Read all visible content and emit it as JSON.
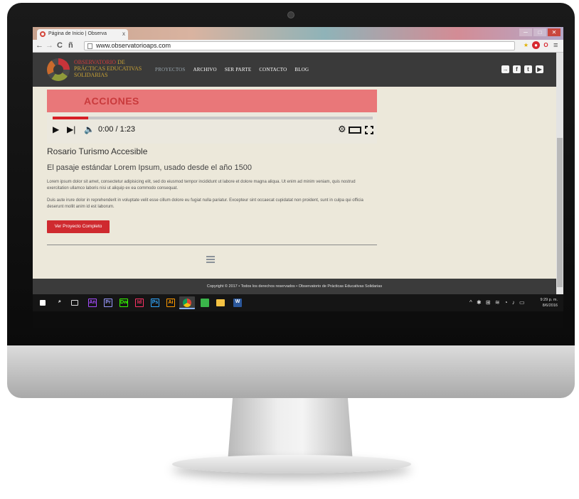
{
  "browser": {
    "tab_title": "Página de Inicio | Observa",
    "tab_close": "x",
    "url": "www.observatorioaps.com",
    "back": "←",
    "forward": "→",
    "reload": "C",
    "home": "ñ",
    "menu": "≡",
    "window_controls": [
      "─",
      "□",
      "✕"
    ]
  },
  "site": {
    "logo": {
      "line1_a": "OBSERVATORIO",
      "line1_b": "DE",
      "line2_a": "PRÁCTICAS",
      "line2_b": "EDUCATIVAS",
      "line3": "SOLIDARIAS"
    },
    "nav": [
      "PROYECTOS",
      "ARCHIVO",
      "SER PARTE",
      "CONTACTO",
      "BLOG"
    ],
    "nav_active": "PROYECTOS",
    "social_icons": [
      "login-icon",
      "facebook-icon",
      "twitter-icon",
      "youtube-icon"
    ]
  },
  "video": {
    "banner_text": "ACCIONES",
    "time": "0:00 / 1:23",
    "progress": 0.11
  },
  "project": {
    "title": "Rosario Turismo Accesible",
    "subtitle": "El pasaje estándar Lorem Ipsum, usado desde el año 1500",
    "paragraph1": "Lorem ipsum dolor sit amet, consectetur adipisicing elit, sed do eiusmod tempor incididunt ut labore et dolore magna aliqua. Ut enim ad minim veniam, quis nostrud exercitation ullamco laboris nisi ut aliquip ex ea commodo consequat.",
    "paragraph2": "Duis aute irure dolor in reprehenderit in voluptate velit esse cillum dolore eu fugiat nulla pariatur. Excepteur sint occaecat cupidatat non proident, sunt in culpa qui officia deserunt mollit anim id est laborum.",
    "button": "Ver Proyecto Completo"
  },
  "footer": {
    "text": "Copyright © 2017 • Todos los derechos reservados • Observatorio de Prácticas Educativas Solidarias"
  },
  "taskbar": {
    "apps": [
      {
        "name": "start-icon",
        "label": "",
        "color": "#ffffff"
      },
      {
        "name": "search-icon",
        "label": "",
        "color": "#ffffff"
      },
      {
        "name": "task-view-icon",
        "label": "",
        "color": "#ffffff"
      },
      {
        "name": "animate-icon",
        "label": "An",
        "color": "#a64dff"
      },
      {
        "name": "premiere-icon",
        "label": "Pr",
        "color": "#9999ff"
      },
      {
        "name": "dreamweaver-icon",
        "label": "Dw",
        "color": "#35fa00"
      },
      {
        "name": "indesign-icon",
        "label": "Id",
        "color": "#ff3366"
      },
      {
        "name": "photoshop-icon",
        "label": "Ps",
        "color": "#31a8ff"
      },
      {
        "name": "illustrator-icon",
        "label": "Ai",
        "color": "#ff9a00"
      },
      {
        "name": "chrome-icon",
        "label": "",
        "color": "#f4c20d"
      },
      {
        "name": "store-icon",
        "label": "",
        "color": "#3ab54a"
      },
      {
        "name": "folder-icon",
        "label": "",
        "color": "#f5c243"
      },
      {
        "name": "word-icon",
        "label": "W",
        "color": "#2b579a"
      }
    ],
    "clock_time": "9:29 p. m.",
    "clock_date": "8/6/2016"
  }
}
